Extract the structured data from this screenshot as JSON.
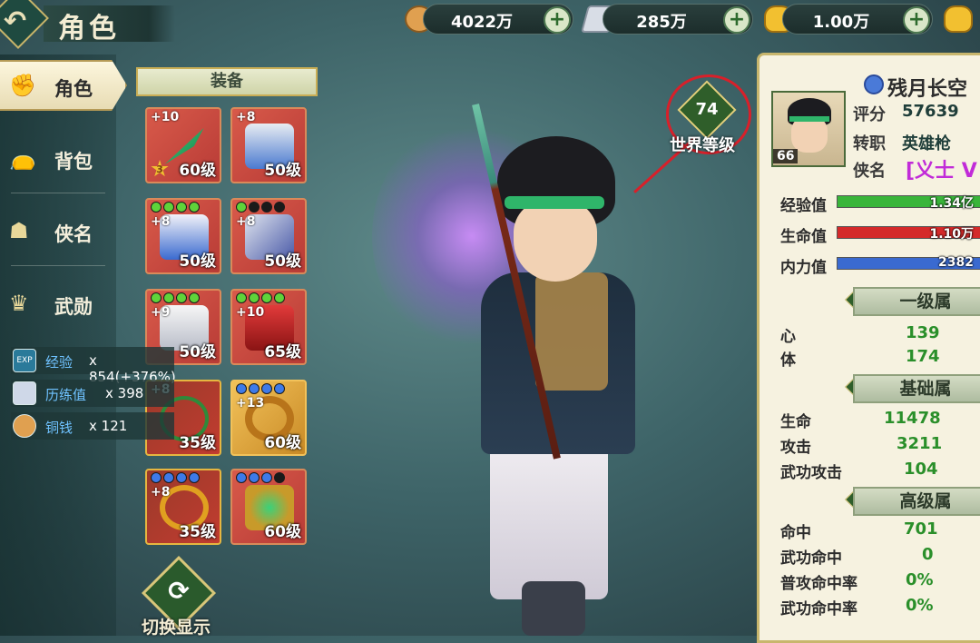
{
  "header": {
    "title": "角色"
  },
  "currencies": [
    {
      "name": "copper",
      "value": "4022万",
      "color": "#e0a050"
    },
    {
      "name": "silver",
      "value": "285万",
      "color": "#d8dde6"
    },
    {
      "name": "gold",
      "value": "1.00万",
      "color": "#f2c030"
    }
  ],
  "nav": {
    "items": [
      {
        "label": "角色",
        "icon": "fist-icon"
      },
      {
        "label": "背包",
        "icon": "bag-icon"
      },
      {
        "label": "侠名",
        "icon": "mask-icon"
      },
      {
        "label": "武勋",
        "icon": "crown-icon"
      }
    ]
  },
  "equipment": {
    "header": "装备",
    "slots": [
      {
        "enhance": "+10",
        "level": "60级",
        "gems": [],
        "star": "3"
      },
      {
        "enhance": "+8",
        "level": "50级",
        "gems": []
      },
      {
        "enhance": "+8",
        "level": "50级",
        "gems": [
          "g",
          "g",
          "g",
          "g"
        ]
      },
      {
        "enhance": "+8",
        "level": "50级",
        "gems": [
          "g",
          "k",
          "k",
          "k"
        ]
      },
      {
        "enhance": "+9",
        "level": "50级",
        "gems": [
          "g",
          "g",
          "g",
          "g"
        ]
      },
      {
        "enhance": "+10",
        "level": "65级",
        "gems": [
          "g",
          "g",
          "g",
          "g"
        ]
      },
      {
        "enhance": "+8",
        "level": "35级",
        "gems": []
      },
      {
        "enhance": "+13",
        "level": "60级",
        "gems": [
          "b",
          "b",
          "b",
          "b"
        ]
      },
      {
        "enhance": "+8",
        "level": "35级",
        "gems": [
          "b",
          "b",
          "b",
          "b"
        ]
      },
      {
        "enhance": "",
        "level": "60级",
        "gems": [
          "b",
          "b",
          "b",
          "k"
        ]
      }
    ],
    "switch_label": "切换显示"
  },
  "rewards": [
    {
      "name": "经验",
      "count": "x 854(+376%)",
      "icon": "EXP"
    },
    {
      "name": "历练值",
      "count": "x 398",
      "icon": ""
    },
    {
      "name": "铜钱",
      "count": "x 121",
      "icon": ""
    }
  ],
  "world_level": {
    "value": "74",
    "label": "世界等级"
  },
  "character": {
    "name": "残月长空",
    "portrait_level": "66",
    "score_label": "评分",
    "score": "57639",
    "job_label": "转职",
    "job": "英雄枪",
    "title_label": "侠名",
    "title": "[义士 V",
    "bars": [
      {
        "label": "经验值",
        "text": "1.34亿",
        "color": "#39b53a",
        "fill": 0.9
      },
      {
        "label": "生命值",
        "text": "1.10万",
        "color": "#d42a2a",
        "fill": 1.0
      },
      {
        "label": "内力值",
        "text": "2382",
        "color": "#3a6ad0",
        "fill": 1.0
      }
    ],
    "sections": [
      {
        "header": "一级属",
        "stats": [
          {
            "k": "心",
            "v": "139"
          },
          {
            "k": "体",
            "v": "174"
          }
        ]
      },
      {
        "header": "基础属",
        "stats": [
          {
            "k": "生命",
            "v": "11478"
          },
          {
            "k": "攻击",
            "v": "3211"
          },
          {
            "k": "武功攻击",
            "v": "104"
          }
        ]
      },
      {
        "header": "高级属",
        "stats": [
          {
            "k": "命中",
            "v": "701"
          },
          {
            "k": "武功命中",
            "v": "0"
          },
          {
            "k": "普攻命中率",
            "v": "0%"
          },
          {
            "k": "武功命中率",
            "v": "0%"
          }
        ]
      }
    ]
  }
}
